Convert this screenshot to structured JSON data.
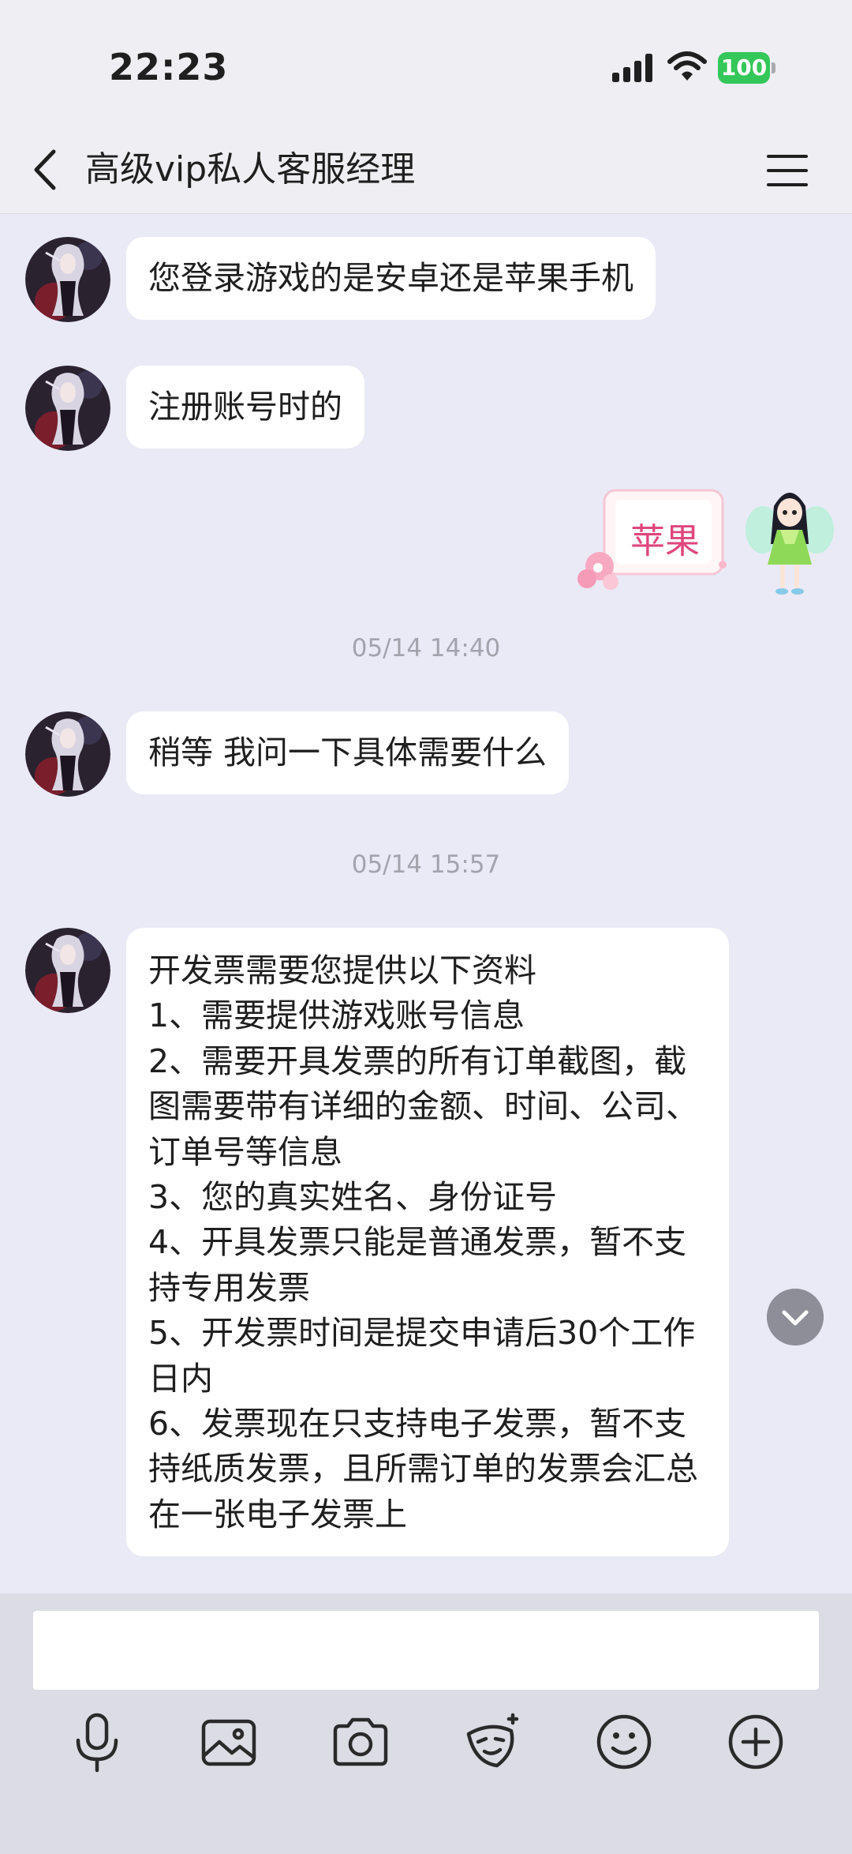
{
  "status_bar": {
    "time": "22:23",
    "battery": "100",
    "battery_color": "#34c759"
  },
  "nav": {
    "title": "高级vip私人客服经理",
    "back_icon": "chevron-left-icon",
    "menu_icon": "hamburger-menu-icon"
  },
  "messages": [
    {
      "sender": "agent",
      "text": "您登录游戏的是安卓还是苹果手机"
    },
    {
      "sender": "agent",
      "text": "注册账号时的"
    },
    {
      "sender": "user",
      "sticker_text": "苹果"
    },
    {
      "timestamp": "05/14 14:40"
    },
    {
      "sender": "agent",
      "text": "稍等 我问一下具体需要什么"
    },
    {
      "timestamp": "05/14 15:57"
    },
    {
      "sender": "agent",
      "text": "开发票需要您提供以下资料\n1、需要提供游戏账号信息\n2、需要开具发票的所有订单截图，截图需要带有详细的金额、时间、公司、订单号等信息\n3、您的真实姓名、身份证号\n4、开具发票只能是普通发票，暂不支持专用发票\n5、开发票时间是提交申请后30个工作日内\n6、发票现在只支持电子发票，暂不支持纸质发票，且所需订单的发票会汇总在一张电子发票上"
    }
  ],
  "input": {
    "value": "",
    "placeholder": ""
  },
  "toolbar": [
    {
      "icon": "microphone-icon"
    },
    {
      "icon": "image-icon"
    },
    {
      "icon": "camera-icon"
    },
    {
      "icon": "sticker-face-icon"
    },
    {
      "icon": "emoji-icon"
    },
    {
      "icon": "plus-circle-icon"
    }
  ],
  "colors": {
    "chat_background": "#eaeaf6",
    "bubble": "#ffffff",
    "timestamp": "#a3a3ad"
  }
}
